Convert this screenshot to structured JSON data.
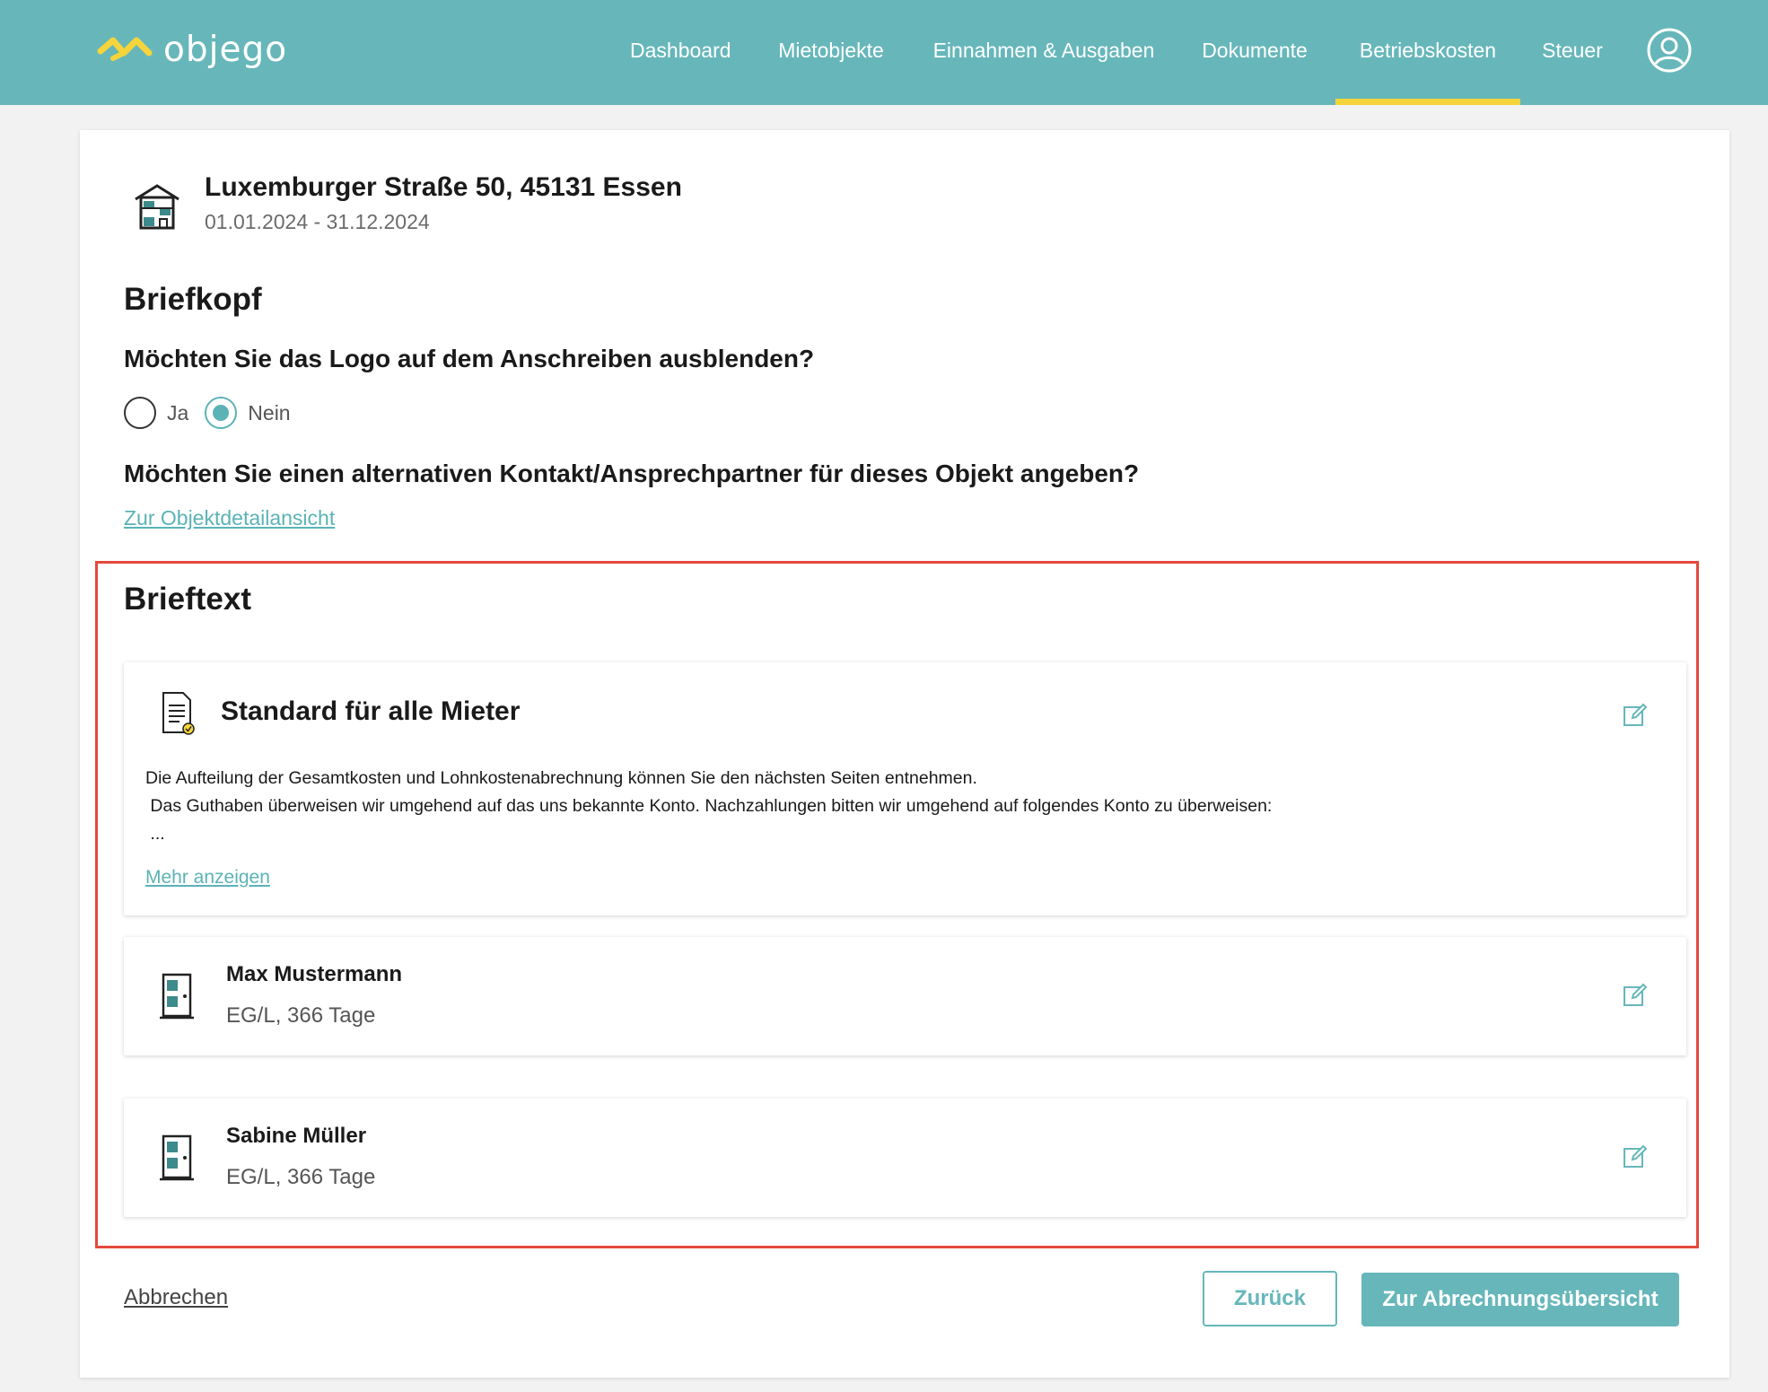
{
  "header": {
    "logo_text": "objego",
    "nav": [
      {
        "label": "Dashboard"
      },
      {
        "label": "Mietobjekte"
      },
      {
        "label": "Einnahmen & Ausgaben"
      },
      {
        "label": "Dokumente"
      },
      {
        "label": "Betriebskosten",
        "active": true
      },
      {
        "label": "Steuer"
      }
    ]
  },
  "property": {
    "address": "Luxemburger Straße 50, 45131 Essen",
    "period": "01.01.2024 - 31.12.2024"
  },
  "briefkopf": {
    "title": "Briefkopf",
    "logo_question": "Möchten Sie das Logo auf dem Anschreiben ausblenden?",
    "options": [
      {
        "label": "Ja",
        "checked": false
      },
      {
        "label": "Nein",
        "checked": true
      }
    ],
    "contact_question": "Möchten Sie einen alternativen Kontakt/Ansprechpartner für dieses Objekt angeben?",
    "detail_link": "Zur Objektdetailansicht"
  },
  "brieftext": {
    "title": "Brieftext",
    "standard": {
      "title": "Standard für alle Mieter",
      "body_line1": "Die Aufteilung der Gesamtkosten und Lohnkostenabrechnung können Sie den nächsten Seiten entnehmen.",
      "body_line2": " Das Guthaben überweisen wir umgehend auf das uns bekannte Konto. Nachzahlungen bitten wir umgehend auf folgendes Konto zu überweisen:",
      "body_line3": " ...",
      "more_link": "Mehr anzeigen"
    },
    "tenants": [
      {
        "name": "Max Mustermann",
        "meta": "EG/L, 366 Tage"
      },
      {
        "name": "Sabine Müller",
        "meta": "EG/L, 366 Tage"
      }
    ]
  },
  "footer": {
    "cancel": "Abbrechen",
    "back": "Zurück",
    "primary": "Zur Abrechnungsübersicht"
  },
  "colors": {
    "brand": "#67b7ba",
    "accent_yellow": "#f5d43c",
    "highlight_red": "#e4493c"
  },
  "icons": [
    "objego-logo-icon",
    "user-avatar-icon",
    "house-icon",
    "document-check-icon",
    "edit-icon",
    "door-icon"
  ]
}
